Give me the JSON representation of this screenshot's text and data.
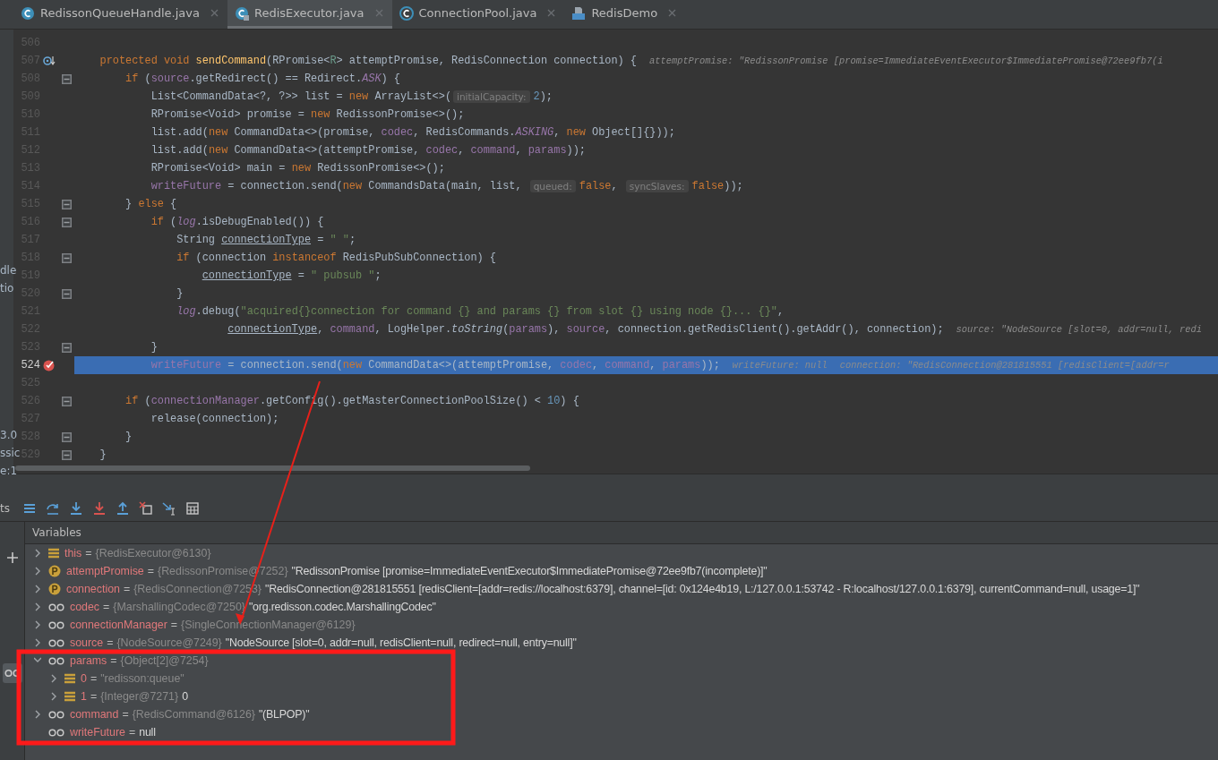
{
  "tabs": [
    {
      "label": "RedissonQueueHandle.java",
      "kind": "class",
      "selected": false
    },
    {
      "label": "RedisExecutor.java",
      "kind": "locked-class",
      "selected": true
    },
    {
      "label": "ConnectionPool.java",
      "kind": "abstract-class",
      "selected": false
    },
    {
      "label": "RedisDemo",
      "kind": "markdown",
      "selected": false
    }
  ],
  "left_panel_fragments": [
    "dle",
    "tio",
    "3.0",
    "ssic",
    "e:1"
  ],
  "editor": {
    "lines": [
      {
        "number": "506",
        "kind": "code",
        "current": false,
        "fold": false
      },
      {
        "number": "507",
        "kind": "override",
        "current": false,
        "fold": false,
        "tokens": [
          {
            "kind": "kw",
            "text": "    protected void "
          },
          {
            "kind": "method",
            "text": "sendCommand"
          },
          {
            "kind": "plain",
            "text": "(RPromise<"
          },
          {
            "kind": "typeparam",
            "text": "R"
          },
          {
            "kind": "plain",
            "text": "> attemptPromise, RedisConnection connection) {"
          },
          {
            "kind": "debug",
            "text": "attemptPromise: \"RedissonPromise [promise=ImmediateEventExecutor$ImmediatePromise@72ee9fb7(i"
          }
        ]
      },
      {
        "number": "508",
        "kind": "code",
        "current": false,
        "fold": true,
        "tokens": [
          {
            "kind": "kw",
            "text": "        if"
          },
          {
            "kind": "plain",
            "text": " ("
          },
          {
            "kind": "field",
            "text": "source"
          },
          {
            "kind": "plain",
            "text": ".getRedirect() == Redirect."
          },
          {
            "kind": "sfield",
            "text": "ASK"
          },
          {
            "kind": "plain",
            "text": ") {"
          }
        ]
      },
      {
        "number": "509",
        "kind": "code",
        "current": false,
        "fold": false,
        "tokens": [
          {
            "kind": "plain",
            "text": "            List<CommandData<?, ?>> list = "
          },
          {
            "kind": "kw",
            "text": "new "
          },
          {
            "kind": "plain",
            "text": "ArrayList<>("
          },
          {
            "kind": "hint",
            "text": "initialCapacity:"
          },
          {
            "kind": "num",
            "text": "2"
          },
          {
            "kind": "plain",
            "text": ");"
          }
        ]
      },
      {
        "number": "510",
        "kind": "code",
        "current": false,
        "fold": false,
        "tokens": [
          {
            "kind": "plain",
            "text": "            RPromise<Void> promise = "
          },
          {
            "kind": "kw",
            "text": "new "
          },
          {
            "kind": "plain",
            "text": "RedissonPromise<>();"
          }
        ]
      },
      {
        "number": "511",
        "kind": "code",
        "current": false,
        "fold": false,
        "tokens": [
          {
            "kind": "plain",
            "text": "            list.add("
          },
          {
            "kind": "kw",
            "text": "new "
          },
          {
            "kind": "plain",
            "text": "CommandData<>(promise, "
          },
          {
            "kind": "field",
            "text": "codec"
          },
          {
            "kind": "plain",
            "text": ", RedisCommands."
          },
          {
            "kind": "sfield",
            "text": "ASKING"
          },
          {
            "kind": "plain",
            "text": ", "
          },
          {
            "kind": "kw",
            "text": "new "
          },
          {
            "kind": "plain",
            "text": "Object[]{}));"
          }
        ]
      },
      {
        "number": "512",
        "kind": "code",
        "current": false,
        "fold": false,
        "tokens": [
          {
            "kind": "plain",
            "text": "            list.add("
          },
          {
            "kind": "kw",
            "text": "new "
          },
          {
            "kind": "plain",
            "text": "CommandData<>(attemptPromise, "
          },
          {
            "kind": "field",
            "text": "codec"
          },
          {
            "kind": "plain",
            "text": ", "
          },
          {
            "kind": "field",
            "text": "command"
          },
          {
            "kind": "plain",
            "text": ", "
          },
          {
            "kind": "field",
            "text": "params"
          },
          {
            "kind": "plain",
            "text": "));"
          }
        ]
      },
      {
        "number": "513",
        "kind": "code",
        "current": false,
        "fold": false,
        "tokens": [
          {
            "kind": "plain",
            "text": "            RPromise<Void> main = "
          },
          {
            "kind": "kw",
            "text": "new "
          },
          {
            "kind": "plain",
            "text": "RedissonPromise<>();"
          }
        ]
      },
      {
        "number": "514",
        "kind": "code",
        "current": false,
        "fold": false,
        "tokens": [
          {
            "kind": "field",
            "text": "            writeFuture"
          },
          {
            "kind": "plain",
            "text": " = connection.send("
          },
          {
            "kind": "kw",
            "text": "new "
          },
          {
            "kind": "plain",
            "text": "CommandsData(main, list, "
          },
          {
            "kind": "hint",
            "text": "queued:"
          },
          {
            "kind": "kw",
            "text": "false"
          },
          {
            "kind": "plain",
            "text": ", "
          },
          {
            "kind": "hint",
            "text": "syncSlaves:"
          },
          {
            "kind": "kw",
            "text": "false"
          },
          {
            "kind": "plain",
            "text": "));"
          }
        ]
      },
      {
        "number": "515",
        "kind": "code",
        "current": false,
        "fold": true,
        "tokens": [
          {
            "kind": "plain",
            "text": "        } "
          },
          {
            "kind": "kw",
            "text": "else"
          },
          {
            "kind": "plain",
            "text": " {"
          }
        ]
      },
      {
        "number": "516",
        "kind": "code",
        "current": false,
        "fold": true,
        "tokens": [
          {
            "kind": "kw",
            "text": "            if"
          },
          {
            "kind": "plain",
            "text": " ("
          },
          {
            "kind": "sfield",
            "text": "log"
          },
          {
            "kind": "plain",
            "text": ".isDebugEnabled()) {"
          }
        ]
      },
      {
        "number": "517",
        "kind": "code",
        "current": false,
        "fold": false,
        "tokens": [
          {
            "kind": "plain",
            "text": "                String "
          },
          {
            "kind": "under",
            "text": "connectionType"
          },
          {
            "kind": "plain",
            "text": " = "
          },
          {
            "kind": "str",
            "text": "\" \""
          },
          {
            "kind": "plain",
            "text": ";"
          }
        ]
      },
      {
        "number": "518",
        "kind": "code",
        "current": false,
        "fold": true,
        "tokens": [
          {
            "kind": "kw",
            "text": "                if"
          },
          {
            "kind": "plain",
            "text": " (connection "
          },
          {
            "kind": "kw",
            "text": "instanceof"
          },
          {
            "kind": "plain",
            "text": " RedisPubSubConnection) {"
          }
        ]
      },
      {
        "number": "519",
        "kind": "code",
        "current": false,
        "fold": false,
        "tokens": [
          {
            "kind": "under",
            "text": "                    connectionType"
          },
          {
            "kind": "plain",
            "text": " = "
          },
          {
            "kind": "str",
            "text": "\" pubsub \""
          },
          {
            "kind": "plain",
            "text": ";"
          }
        ]
      },
      {
        "number": "520",
        "kind": "code",
        "current": false,
        "fold": true,
        "tokens": [
          {
            "kind": "plain",
            "text": "                }"
          }
        ]
      },
      {
        "number": "521",
        "kind": "code",
        "current": false,
        "fold": false,
        "tokens": [
          {
            "kind": "sfield",
            "text": "                log"
          },
          {
            "kind": "plain",
            "text": ".debug("
          },
          {
            "kind": "str",
            "text": "\"acquired{}connection for command {} and params {} from slot {} using node {}... {}\""
          },
          {
            "kind": "plain",
            "text": ","
          }
        ]
      },
      {
        "number": "522",
        "kind": "code",
        "current": false,
        "fold": false,
        "tokens": [
          {
            "kind": "under",
            "text": "                        connectionType"
          },
          {
            "kind": "plain",
            "text": ", "
          },
          {
            "kind": "field",
            "text": "command"
          },
          {
            "kind": "plain",
            "text": ", LogHelper."
          },
          {
            "kind": "italic",
            "text": "toString"
          },
          {
            "kind": "plain",
            "text": "("
          },
          {
            "kind": "field",
            "text": "params"
          },
          {
            "kind": "plain",
            "text": "), "
          },
          {
            "kind": "field",
            "text": "source"
          },
          {
            "kind": "plain",
            "text": ", connection.getRedisClient().getAddr(), connection);"
          },
          {
            "kind": "debug",
            "text": "source: \"NodeSource [slot=0, addr=null, redi"
          }
        ]
      },
      {
        "number": "523",
        "kind": "code",
        "current": false,
        "fold": true,
        "tokens": [
          {
            "kind": "plain",
            "text": "            }"
          }
        ]
      },
      {
        "number": "524",
        "kind": "breakpoint",
        "current": true,
        "fold": false,
        "tokens": [
          {
            "kind": "field",
            "text": "            writeFuture"
          },
          {
            "kind": "plain",
            "text": " = connection.send("
          },
          {
            "kind": "kw",
            "text": "new "
          },
          {
            "kind": "plain",
            "text": "CommandData<>(attemptPromise, "
          },
          {
            "kind": "field",
            "text": "codec"
          },
          {
            "kind": "plain",
            "text": ", "
          },
          {
            "kind": "field",
            "text": "command"
          },
          {
            "kind": "plain",
            "text": ", "
          },
          {
            "kind": "field",
            "text": "params"
          },
          {
            "kind": "plain",
            "text": "));"
          },
          {
            "kind": "debug",
            "text": "writeFuture: null"
          },
          {
            "kind": "debug",
            "text": "connection: \"RedisConnection@281815551 [redisClient=[addr=r"
          }
        ]
      },
      {
        "number": "525",
        "kind": "code",
        "current": false,
        "fold": false
      },
      {
        "number": "526",
        "kind": "code",
        "current": false,
        "fold": true,
        "tokens": [
          {
            "kind": "kw",
            "text": "        if"
          },
          {
            "kind": "plain",
            "text": " ("
          },
          {
            "kind": "field",
            "text": "connectionManager"
          },
          {
            "kind": "plain",
            "text": ".getConfig().getMasterConnectionPoolSize() < "
          },
          {
            "kind": "num",
            "text": "10"
          },
          {
            "kind": "plain",
            "text": ") {"
          }
        ]
      },
      {
        "number": "527",
        "kind": "code",
        "current": false,
        "fold": false,
        "tokens": [
          {
            "kind": "plain",
            "text": "            release(connection);"
          }
        ]
      },
      {
        "number": "528",
        "kind": "code",
        "current": false,
        "fold": true,
        "tokens": [
          {
            "kind": "plain",
            "text": "        }"
          }
        ]
      },
      {
        "number": "529",
        "kind": "code",
        "current": false,
        "fold": true,
        "tokens": [
          {
            "kind": "plain",
            "text": "    }"
          }
        ]
      }
    ]
  },
  "debug_toolbar": {
    "fragment": "ts"
  },
  "variables_panel": {
    "title": "Variables",
    "variables": [
      {
        "kind": "field",
        "name": "this",
        "op": "=",
        "detail": "{RedisExecutor@6130}",
        "expandable": true,
        "expanded": false
      },
      {
        "kind": "parameter",
        "name": "attemptPromise",
        "op": "=",
        "detail": "{RedissonPromise@7252}",
        "value": "\"RedissonPromise [promise=ImmediateEventExecutor$ImmediatePromise@72ee9fb7(incomplete)]\"",
        "expandable": true,
        "expanded": false
      },
      {
        "kind": "parameter",
        "name": "connection",
        "op": "=",
        "detail": "{RedisConnection@7253}",
        "value": "\"RedisConnection@281815551 [redisClient=[addr=redis://localhost:6379], channel=[id: 0x124e4b19, L:/127.0.0.1:53742 - R:localhost/127.0.0.1:6379], currentCommand=null, usage=1]\"",
        "expandable": true,
        "expanded": false
      },
      {
        "kind": "watch",
        "name": "codec",
        "op": "=",
        "detail": "{MarshallingCodec@7250}",
        "value": "\"org.redisson.codec.MarshallingCodec\"",
        "expandable": true,
        "expanded": false
      },
      {
        "kind": "watch",
        "name": "connectionManager",
        "op": "=",
        "detail": "{SingleConnectionManager@6129}",
        "expandable": true,
        "expanded": false
      },
      {
        "kind": "watch",
        "name": "source",
        "op": "=",
        "detail": "{NodeSource@7249}",
        "value": "\"NodeSource [slot=0, addr=null, redisClient=null, redirect=null, entry=null]\"",
        "expandable": true,
        "expanded": false
      },
      {
        "kind": "watch",
        "name": "params",
        "op": "=",
        "detail": "{Object[2]@7254}",
        "expandable": true,
        "expanded": true,
        "children": [
          {
            "kind": "field",
            "name": "0",
            "op": "=",
            "detail": "\"redisson:queue\"",
            "expandable": true,
            "expanded": false
          },
          {
            "kind": "field",
            "name": "1",
            "op": "=",
            "detail": "{Integer@7271}",
            "value": "0",
            "expandable": true,
            "expanded": false
          }
        ]
      },
      {
        "kind": "watch",
        "name": "command",
        "op": "=",
        "detail": "{RedisCommand@6126}",
        "value": "\"(BLPOP)\"",
        "expandable": true,
        "expanded": false
      },
      {
        "kind": "watch",
        "name": "writeFuture",
        "op": "=",
        "value": "null",
        "expandable": false
      }
    ]
  }
}
